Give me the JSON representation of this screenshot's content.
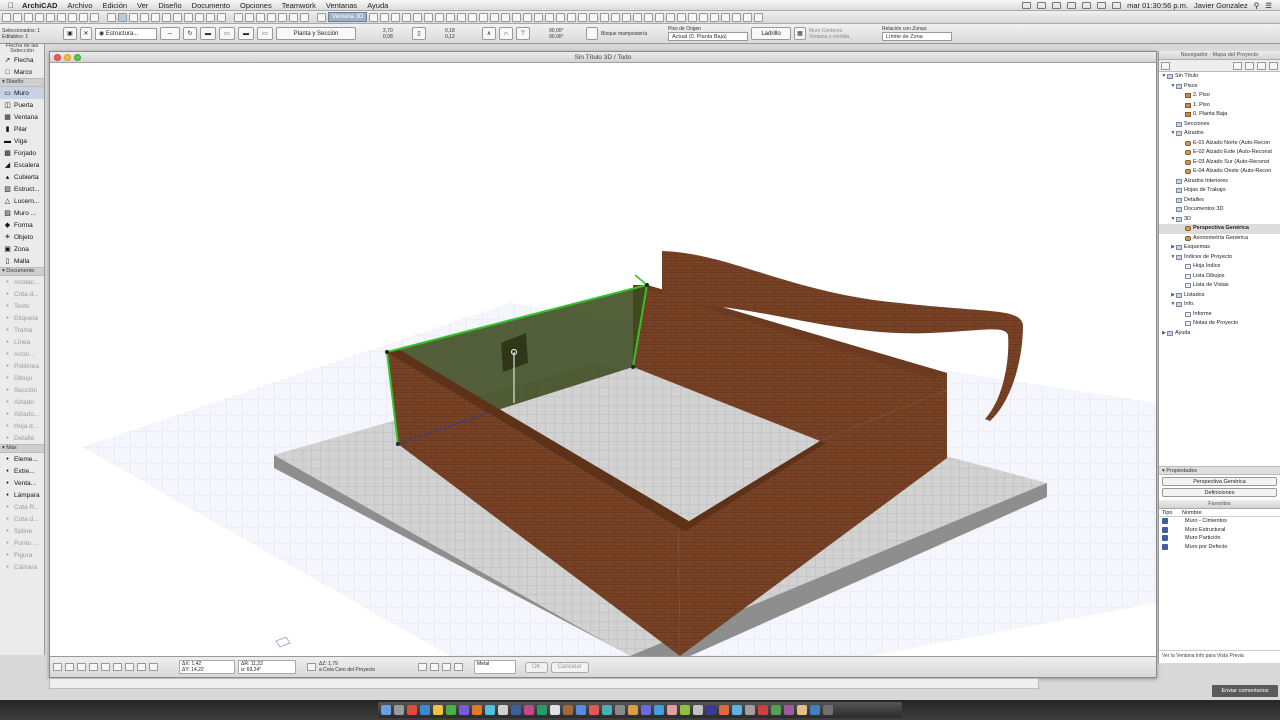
{
  "menubar": {
    "app_name": "ArchiCAD",
    "menus": [
      "Archivo",
      "Edición",
      "Ver",
      "Diseño",
      "Documento",
      "Opciones",
      "Teamwork",
      "Ventanas",
      "Ayuda"
    ],
    "clock": "mar 01:30:56 p.m.",
    "user": "Javier Gonzalez"
  },
  "toolbar": {
    "view3d_label": "Ventana 3D"
  },
  "infobox": {
    "selection_label": "Selección:",
    "selected_count": "Seleccionados: 1",
    "editable_count": "Editables: 1",
    "structure_label": "Estructura...",
    "floor_section": "Planta y Sección",
    "height_top": "2,70",
    "height_bottom": "0,08",
    "thickness_top": "0,18",
    "thickness_bottom": "0,12",
    "angle_top": "90,00°",
    "angle_bottom": "90,00°",
    "material": "Bloque mampostería",
    "origin_floor_label": "Piso de Origen",
    "origin_floor": "Actual (0. Planta Baja)",
    "brick": "Ladrillo",
    "outline_label": "Muro Contorno",
    "outline_value": "Ventana o medida",
    "zone_label": "Relación con Zonas:",
    "zone_value": "Límite de Zona"
  },
  "toolbox": {
    "header": "Flecha de las",
    "selection": "Selección",
    "sections": {
      "diseno": "Diseño",
      "documento": "Documento",
      "mas": "Más"
    },
    "tools_top": [
      {
        "label": "Flecha",
        "icon": "arrow-icon"
      },
      {
        "label": "Marco",
        "icon": "marquee-icon"
      }
    ],
    "tools_design": [
      {
        "label": "Muro",
        "icon": "wall-icon",
        "active": true
      },
      {
        "label": "Puerta",
        "icon": "door-icon"
      },
      {
        "label": "Ventana",
        "icon": "window-icon"
      },
      {
        "label": "Pilar",
        "icon": "column-icon"
      },
      {
        "label": "Viga",
        "icon": "beam-icon"
      },
      {
        "label": "Forjado",
        "icon": "slab-icon"
      },
      {
        "label": "Escalera",
        "icon": "stair-icon"
      },
      {
        "label": "Cubierta",
        "icon": "roof-icon"
      },
      {
        "label": "Estruct...",
        "icon": "curtain-wall-icon"
      },
      {
        "label": "Lucern...",
        "icon": "skylight-icon"
      },
      {
        "label": "Muro ...",
        "icon": "curtain-icon"
      },
      {
        "label": "Forma",
        "icon": "morph-icon"
      },
      {
        "label": "Objeto",
        "icon": "object-icon"
      },
      {
        "label": "Zona",
        "icon": "zone-icon"
      },
      {
        "label": "Malla",
        "icon": "mesh-icon"
      }
    ],
    "tools_doc": [
      {
        "label": "Acotac...",
        "icon": "dimension-icon"
      },
      {
        "label": "Cota d...",
        "icon": "level-dimension-icon"
      },
      {
        "label": "Texto",
        "icon": "text-icon"
      },
      {
        "label": "Etiqueta",
        "icon": "label-icon"
      },
      {
        "label": "Trama",
        "icon": "fill-icon"
      },
      {
        "label": "Línea",
        "icon": "line-icon"
      },
      {
        "label": "Arco/...",
        "icon": "arc-icon"
      },
      {
        "label": "Polilínea",
        "icon": "polyline-icon"
      },
      {
        "label": "Dibujo",
        "icon": "drawing-icon"
      },
      {
        "label": "Sección",
        "icon": "section-icon"
      },
      {
        "label": "Alzado",
        "icon": "elevation-icon"
      },
      {
        "label": "Alzado...",
        "icon": "interior-elevation-icon"
      },
      {
        "label": "Hoja d...",
        "icon": "worksheet-icon"
      },
      {
        "label": "Detalle",
        "icon": "detail-icon"
      }
    ],
    "tools_more": [
      {
        "label": "Eleme...",
        "icon": "element-icon"
      },
      {
        "label": "Extre...",
        "icon": "extrude-icon"
      },
      {
        "label": "Venta...",
        "icon": "window-more-icon"
      },
      {
        "label": "Lámpara",
        "icon": "lamp-icon"
      },
      {
        "label": "Cota R...",
        "icon": "radial-dimension-icon"
      },
      {
        "label": "Cota d...",
        "icon": "angle-dimension-icon"
      },
      {
        "label": "Spline",
        "icon": "spline-icon"
      },
      {
        "label": "Punto ...",
        "icon": "hotspot-icon"
      },
      {
        "label": "Figura",
        "icon": "figure-icon"
      },
      {
        "label": "Cámara",
        "icon": "camera-icon"
      }
    ]
  },
  "window": {
    "title": "Sin Título 3D / Todo"
  },
  "statusbar": {
    "dx": "ΔX: 1,42",
    "dy": "ΔY: 14,22",
    "ar": "ΔR: 11,22",
    "ang": "α: 69,24°",
    "az": "ΔZ: 1,79",
    "ref": "a Cota Cero del Proyecto",
    "mode_label": "Metal",
    "ok": "OK",
    "cancel": "Cancelar"
  },
  "navigator": {
    "title": "Navegador · Mapa del Proyecto",
    "tree": [
      {
        "label": "Sin Título",
        "level": 0,
        "icon": "folder",
        "tw": "▼"
      },
      {
        "label": "Pisos",
        "level": 1,
        "icon": "folder",
        "tw": "▼"
      },
      {
        "label": "2. Piso",
        "level": 2,
        "icon": "story",
        "tw": ""
      },
      {
        "label": "1. Piso",
        "level": 2,
        "icon": "story",
        "tw": ""
      },
      {
        "label": "0. Planta Baja",
        "level": 2,
        "icon": "story",
        "tw": ""
      },
      {
        "label": "Secciones",
        "level": 1,
        "icon": "folder",
        "tw": ""
      },
      {
        "label": "Alzados",
        "level": 1,
        "icon": "folder",
        "tw": "▼"
      },
      {
        "label": "E-01 Alzado Norte (Auto-Recon",
        "level": 2,
        "icon": "elev",
        "tw": ""
      },
      {
        "label": "E-02 Alzado Este (Auto-Reconst",
        "level": 2,
        "icon": "elev",
        "tw": ""
      },
      {
        "label": "E-03 Alzado Sur (Auto-Reconst",
        "level": 2,
        "icon": "elev",
        "tw": ""
      },
      {
        "label": "E-04 Alzado Oeste (Auto-Recon",
        "level": 2,
        "icon": "elev",
        "tw": ""
      },
      {
        "label": "Alzados Interiores",
        "level": 1,
        "icon": "folder",
        "tw": ""
      },
      {
        "label": "Hojas de Trabajo",
        "level": 1,
        "icon": "folder",
        "tw": ""
      },
      {
        "label": "Detalles",
        "level": 1,
        "icon": "folder",
        "tw": ""
      },
      {
        "label": "Documentos 3D",
        "level": 1,
        "icon": "folder",
        "tw": ""
      },
      {
        "label": "3D",
        "level": 1,
        "icon": "folder",
        "tw": "▼"
      },
      {
        "label": "Perspectiva Genérica",
        "level": 2,
        "icon": "elev",
        "tw": "",
        "selected": true
      },
      {
        "label": "Axonometría Genérica",
        "level": 2,
        "icon": "elev",
        "tw": ""
      },
      {
        "label": "Esquemas",
        "level": 1,
        "icon": "folder",
        "tw": "▶"
      },
      {
        "label": "Índices de Proyecto",
        "level": 1,
        "icon": "folder",
        "tw": "▼"
      },
      {
        "label": "Hoja Índice",
        "level": 2,
        "icon": "file",
        "tw": ""
      },
      {
        "label": "Lista Dibujos",
        "level": 2,
        "icon": "file",
        "tw": ""
      },
      {
        "label": "Lista de Vistas",
        "level": 2,
        "icon": "file",
        "tw": ""
      },
      {
        "label": "Listados",
        "level": 1,
        "icon": "folder",
        "tw": "▶"
      },
      {
        "label": "Info.",
        "level": 1,
        "icon": "folder",
        "tw": "▼"
      },
      {
        "label": "Informe",
        "level": 2,
        "icon": "file",
        "tw": ""
      },
      {
        "label": "Notas de Proyecto",
        "level": 2,
        "icon": "file",
        "tw": ""
      },
      {
        "label": "Ayuda",
        "level": 0,
        "icon": "folder",
        "tw": "▶"
      }
    ],
    "properties_label": "Propiedades",
    "properties_view": "Perspectiva Genérica",
    "definitions_btn": "Definiciones",
    "favorites_label": "Favoritos",
    "fav_type_col": "Tipo",
    "fav_name_col": "Nombre",
    "favorites": [
      "Muro - Cimientos",
      "Muro Estructural",
      "Muro Partición",
      "Muro por Defecto"
    ],
    "footer": "Ver la Ventana Info para Vista Previa"
  },
  "feedback_btn": "Enviar comentarios",
  "colors": {
    "brick": "#7a4326",
    "brick_dark": "#5a2f1a",
    "selection": "#33c22a",
    "slab": "#cfcfcf",
    "grid": "#e2e6f4"
  }
}
